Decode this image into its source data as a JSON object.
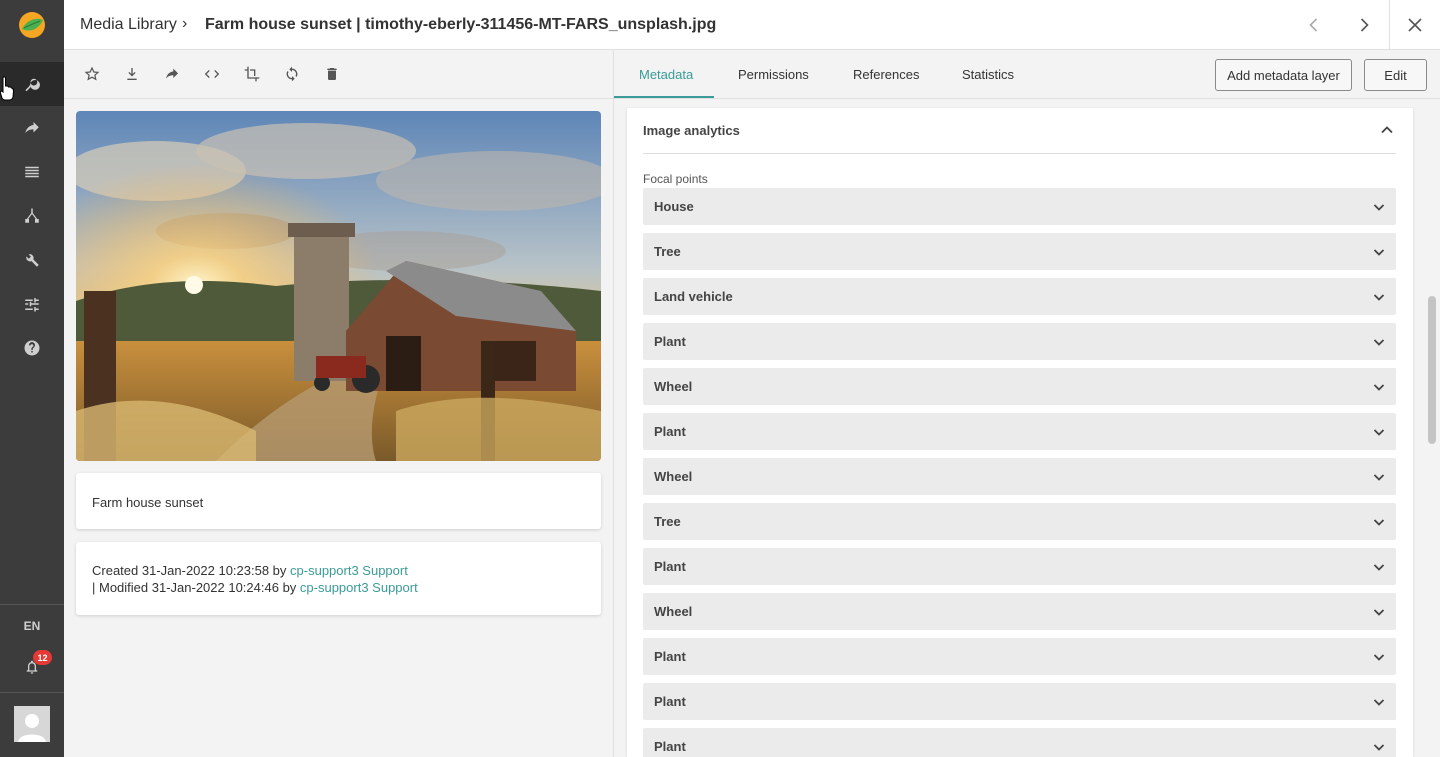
{
  "header": {
    "breadcrumb_root": "Media Library",
    "breadcrumb_separator": "›",
    "title": "Farm house sunset | timothy-eberly-311456-MT-FARS_unsplash.jpg"
  },
  "nav": {
    "language": "EN",
    "notification_count": "12"
  },
  "asset": {
    "title": "Farm house sunset",
    "created_prefix": "Created 31-Jan-2022 10:23:58 by ",
    "created_user": "cp-support3 Support",
    "modified_prefix": "| Modified 31-Jan-2022 10:24:46 by ",
    "modified_user": "cp-support3 Support"
  },
  "tabs": [
    {
      "label": "Metadata",
      "active": true
    },
    {
      "label": "Permissions",
      "active": false
    },
    {
      "label": "References",
      "active": false
    },
    {
      "label": "Statistics",
      "active": false
    }
  ],
  "actions": {
    "add_layer": "Add metadata layer",
    "edit": "Edit"
  },
  "analytics": {
    "title": "Image analytics",
    "focal_label": "Focal points",
    "focal_points": [
      "House",
      "Tree",
      "Land vehicle",
      "Plant",
      "Wheel",
      "Plant",
      "Wheel",
      "Tree",
      "Plant",
      "Wheel",
      "Plant",
      "Plant",
      "Plant"
    ]
  },
  "colors": {
    "accent": "#3a9b98",
    "nav_bg": "#3c3c3c",
    "badge": "#e53935"
  }
}
